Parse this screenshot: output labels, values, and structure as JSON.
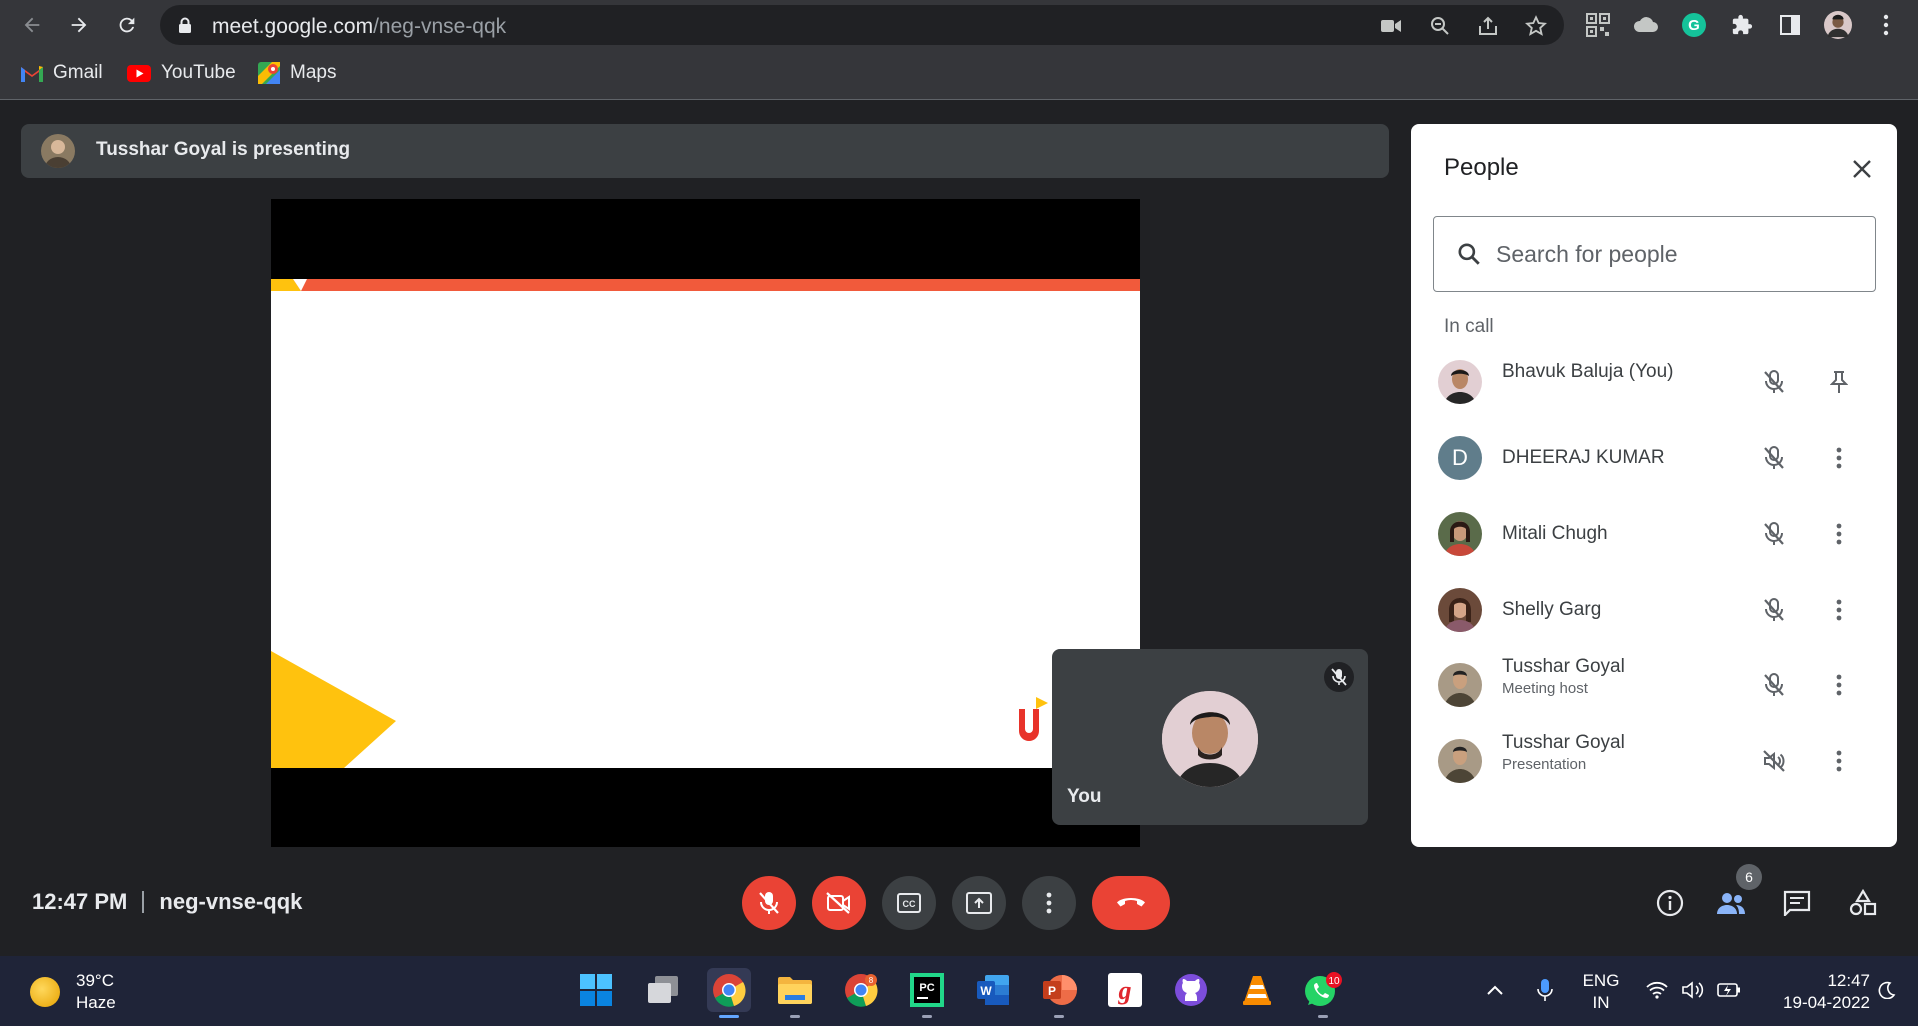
{
  "browser": {
    "url_host": "meet.google.com",
    "url_path": "/neg-vnse-qqk",
    "bookmarks": [
      {
        "label": "Gmail",
        "icon": "gmail-icon"
      },
      {
        "label": "YouTube",
        "icon": "youtube-icon"
      },
      {
        "label": "Maps",
        "icon": "maps-icon"
      }
    ]
  },
  "meet": {
    "presenting_banner": "Tusshar Goyal is presenting",
    "self_tile_label": "You",
    "time": "12:47 PM",
    "meeting_code": "neg-vnse-qqk",
    "participant_count": "6"
  },
  "people_panel": {
    "title": "People",
    "search_placeholder": "Search for people",
    "section_label": "In call",
    "participants": [
      {
        "name": "Bhavuk Baluja (You)",
        "subtitle": "",
        "avatar": "photo",
        "action": "pin-icon"
      },
      {
        "name": "DHEERAJ KUMAR",
        "subtitle": "",
        "avatar": "D",
        "action": "more-vert-icon"
      },
      {
        "name": "Mitali Chugh",
        "subtitle": "",
        "avatar": "photo",
        "action": "more-vert-icon"
      },
      {
        "name": "Shelly Garg",
        "subtitle": "",
        "avatar": "photo",
        "action": "more-vert-icon"
      },
      {
        "name": "Tusshar Goyal",
        "subtitle": "Meeting host",
        "avatar": "photo",
        "action": "more-vert-icon"
      },
      {
        "name": "Tusshar Goyal",
        "subtitle": "Presentation",
        "avatar": "photo",
        "action": "more-vert-icon"
      }
    ]
  },
  "taskbar": {
    "weather_temp": "39°C",
    "weather_desc": "Haze",
    "lang_line1": "ENG",
    "lang_line2": "IN",
    "clock_time": "12:47",
    "clock_date": "19-04-2022",
    "chrome_badge": "8",
    "whatsapp_badge": "10"
  },
  "colors": {
    "accent_red": "#ea4335",
    "panel_bg": "#ffffff",
    "meet_bg": "#202124"
  }
}
